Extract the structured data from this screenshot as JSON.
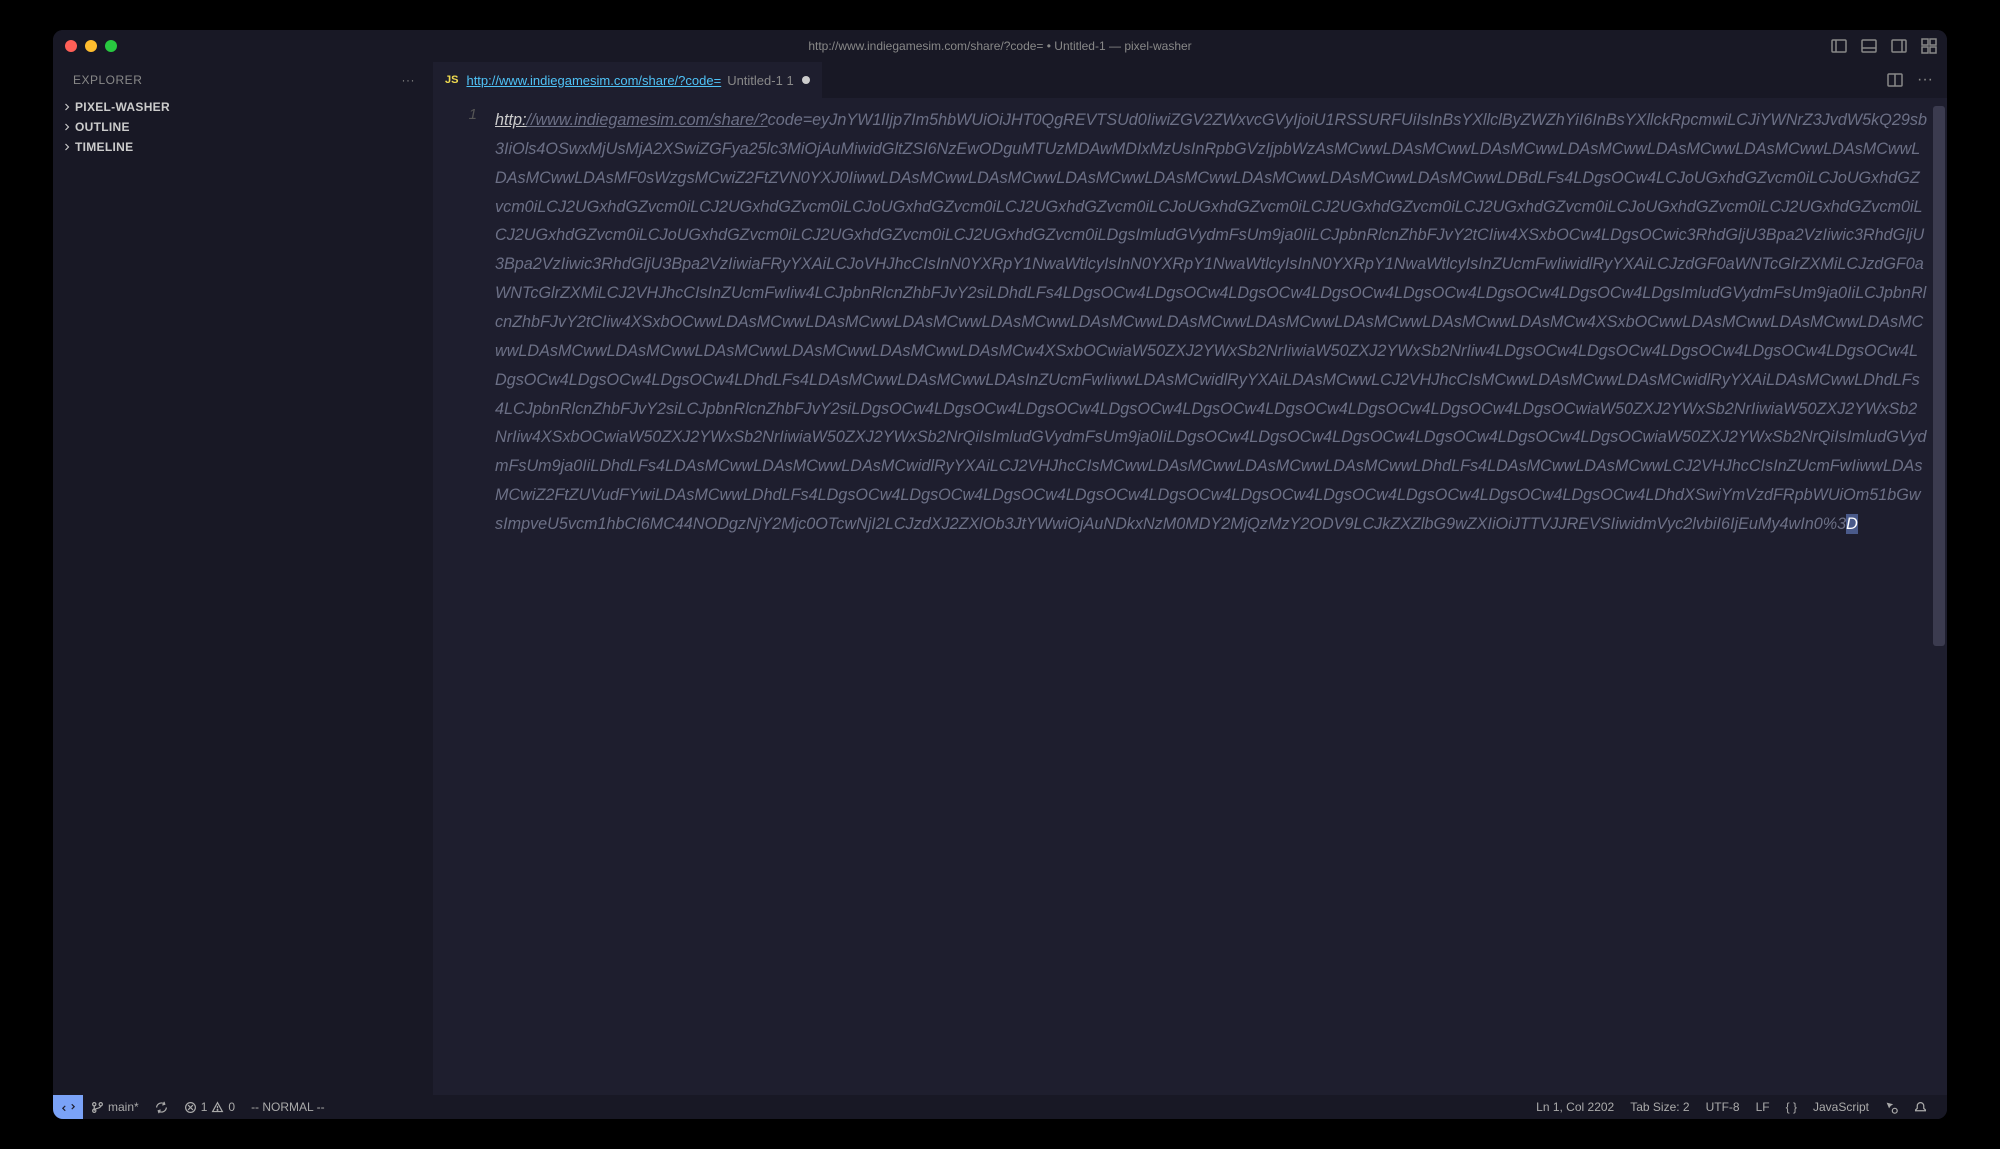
{
  "titlebar": {
    "title": "http://www.indiegamesim.com/share/?code= • Untitled-1 — pixel-washer"
  },
  "sidebar": {
    "header": "EXPLORER",
    "sections": [
      {
        "label": "PIXEL-WASHER"
      },
      {
        "label": "OUTLINE"
      },
      {
        "label": "TIMELINE"
      }
    ]
  },
  "tab": {
    "file_icon": "JS",
    "name": "http://www.indiegamesim.com/share/?code=",
    "suffix": "Untitled-1",
    "suffix_badge": "1"
  },
  "editor": {
    "line_number": "1",
    "scheme": "http:",
    "rest_first": "//www.indiegamesim.com/share/?",
    "rest_body": "code=eyJnYW1lIjp7Im5hbWUiOiJHT0QgREVTSUd0IiwiZGV2ZWxvcGVyIjoiU1RSSURFUiIsInBsYXllclByZWZhYiI6InBsYXllckRpcmwiLCJiYWNrZ3JvdW5kQ29sb3IiOls4OSwxMjUsMjA2XSwiZGFya25lc3MiOjAuMiwidGltZSI6NzEwODguMTUzMDAwMDIxMzUsInRpbGVzIjpbWzAsMCwwLDAsMCwwLDAsMCwwLDAsMCwwLDAsMCwwLDAsMCwwLDAsMCwwLDAsMCwwLDAsMF0sWzgsMCwiZ2FtZVN0YXJ0IiwwLDAsMCwwLDAsMCwwLDAsMCwwLDAsMCwwLDAsMCwwLDAsMCwwLDAsMCwwLDBdLFs4LDgsOCw4LCJoUGxhdGZvcm0iLCJoUGxhdGZvcm0iLCJ2UGxhdGZvcm0iLCJ2UGxhdGZvcm0iLCJoUGxhdGZvcm0iLCJ2UGxhdGZvcm0iLCJoUGxhdGZvcm0iLCJ2UGxhdGZvcm0iLCJ2UGxhdGZvcm0iLCJoUGxhdGZvcm0iLCJ2UGxhdGZvcm0iLCJ2UGxhdGZvcm0iLCJoUGxhdGZvcm0iLCJ2UGxhdGZvcm0iLCJ2UGxhdGZvcm0iLDgsImludGVydmFsUm9ja0IiLCJpbnRlcnZhbFJvY2tCIiw4XSxbOCw4LDgsOCwic3RhdGljU3Bpa2VzIiwic3RhdGljU3Bpa2VzIiwic3RhdGljU3Bpa2VzIiwiaFRyYXAiLCJoVHJhcCIsInN0YXRpY1NwaWtlcyIsInN0YXRpY1NwaWtlcyIsInN0YXRpY1NwaWtlcyIsInZUcmFwIiwidlRyYXAiLCJzdGF0aWNTcGlrZXMiLCJzdGF0aWNTcGlrZXMiLCJ2VHJhcCIsInZUcmFwIiw4LCJpbnRlcnZhbFJvY2siLDhdLFs4LDgsOCw4LDgsOCw4LDgsOCw4LDgsOCw4LDgsOCw4LDgsOCw4LDgsOCw4LDgsImludGVydmFsUm9ja0IiLCJpbnRlcnZhbFJvY2tCIiw4XSxbOCwwLDAsMCwwLDAsMCwwLDAsMCwwLDAsMCwwLDAsMCwwLDAsMCwwLDAsMCwwLDAsMCwwLDAsMCwwLDAsMCw4XSxbOCwwLDAsMCwwLDAsMCwwLDAsMCwwLDAsMCwwLDAsMCwwLDAsMCwwLDAsMCwwLDAsMCwwLDAsMCw4XSxbOCwiaW50ZXJ2YWxSb2NrIiwiaW50ZXJ2YWxSb2NrIiw4LDgsOCw4LDgsOCw4LDgsOCw4LDgsOCw4LDgsOCw4LDgsOCw4LDgsOCw4LDgsOCw4LDhdLFs4LDAsMCwwLDAsMCwwLDAsInZUcmFwIiwwLDAsMCwidlRyYXAiLDAsMCwwLCJ2VHJhcCIsMCwwLDAsMCwwLDAsMCwidlRyYXAiLDAsMCwwLDhdLFs4LCJpbnRlcnZhbFJvY2siLCJpbnRlcnZhbFJvY2siLDgsOCw4LDgsOCw4LDgsOCw4LDgsOCw4LDgsOCw4LDgsOCw4LDgsOCw4LDgsOCw4LDgsOCwiaW50ZXJ2YWxSb2NrIiwiaW50ZXJ2YWxSb2NrIiw4XSxbOCwiaW50ZXJ2YWxSb2NrIiwiaW50ZXJ2YWxSb2NrQiIsImludGVydmFsUm9ja0IiLDgsOCw4LDgsOCw4LDgsOCw4LDgsOCw4LDgsOCw4LDgsOCwiaW50ZXJ2YWxSb2NrQiIsImludGVydmFsUm9ja0IiLDhdLFs4LDAsMCwwLDAsMCwwLDAsMCwidlRyYXAiLCJ2VHJhcCIsMCwwLDAsMCwwLDAsMCwwLDAsMCwwLDhdLFs4LDAsMCwwLDAsMCwwLCJ2VHJhcCIsInZUcmFwIiwwLDAsMCwiZ2FtZUVudFYwiLDAsMCwwLDhdLFs4LDgsOCw4LDgsOCw4LDgsOCw4LDgsOCw4LDgsOCw4LDgsOCw4LDgsOCw4LDgsOCw4LDgsOCw4LDgsOCw4LDhdXSwiYmVzdFRpbWUiOm51bGwsImpveU5vcm1hbCI6MC44NODgzNjY2Mjc0OTcwNjI2LCJzdXJ2ZXlOb3JtYWwiOjAuNDkxNzM0MDY2MjQzMzY2ODV9LCJkZXZlbG9wZXIiOiJTTVJJREVSIiwidmVyc2lvbiI6IjEuMy4wIn0%3",
    "cursor_char": "D"
  },
  "status": {
    "branch": "main*",
    "errors": "1",
    "warnings": "0",
    "mode": "-- NORMAL --",
    "position": "Ln 1, Col 2202",
    "tab_size": "Tab Size: 2",
    "encoding": "UTF-8",
    "eol": "LF",
    "bracket": "{ }",
    "language": "JavaScript"
  }
}
